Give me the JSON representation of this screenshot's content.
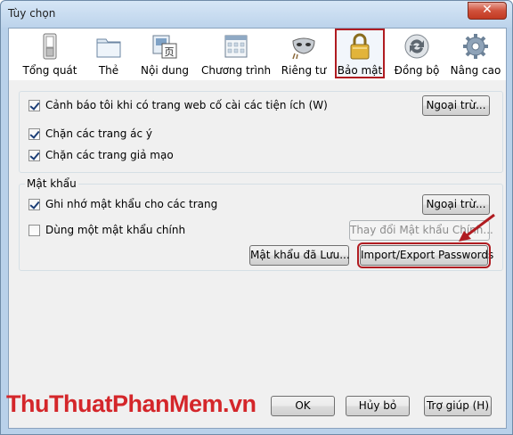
{
  "window": {
    "title": "Tùy chọn",
    "close_glyph": "✕"
  },
  "toolbar": {
    "items": [
      {
        "label": "Tổng quát",
        "icon": "switch-icon"
      },
      {
        "label": "Thẻ",
        "icon": "tabs-icon"
      },
      {
        "label": "Nội dung",
        "icon": "content-icon"
      },
      {
        "label": "Chương trình",
        "icon": "applications-icon"
      },
      {
        "label": "Riêng tư",
        "icon": "mask-icon"
      },
      {
        "label": "Bảo mật",
        "icon": "padlock-icon",
        "selected": true
      },
      {
        "label": "Đồng bộ",
        "icon": "sync-icon"
      },
      {
        "label": "Nâng cao",
        "icon": "gear-icon"
      }
    ]
  },
  "security": {
    "warn_addons": {
      "label": "Cảnh báo tôi khi có trang web cố cài các tiện ích (W)",
      "checked": true
    },
    "block_attack": {
      "label": "Chặn các trang ác ý",
      "checked": true
    },
    "block_forgery": {
      "label": "Chặn các trang giả mạo",
      "checked": true
    },
    "exceptions_button": "Ngoại trừ..."
  },
  "passwords": {
    "legend": "Mật khẩu",
    "remember": {
      "label": "Ghi nhớ mật khẩu cho các trang",
      "checked": true
    },
    "master": {
      "label": "Dùng một mật khẩu chính",
      "checked": false
    },
    "exceptions_button": "Ngoại trừ...",
    "change_master_button": "Thay đổi Mật khẩu Chính...",
    "saved_button": "Mật khẩu đã Lưu...",
    "import_export_button": "Import/Export Passwords"
  },
  "footer": {
    "ok": "OK",
    "cancel": "Hủy bỏ",
    "help": "Trợ giúp (H)"
  },
  "watermark": "ThuThuatPhanMem.vn",
  "colors": {
    "highlight": "#b01c21",
    "watermark": "#d4262a"
  }
}
